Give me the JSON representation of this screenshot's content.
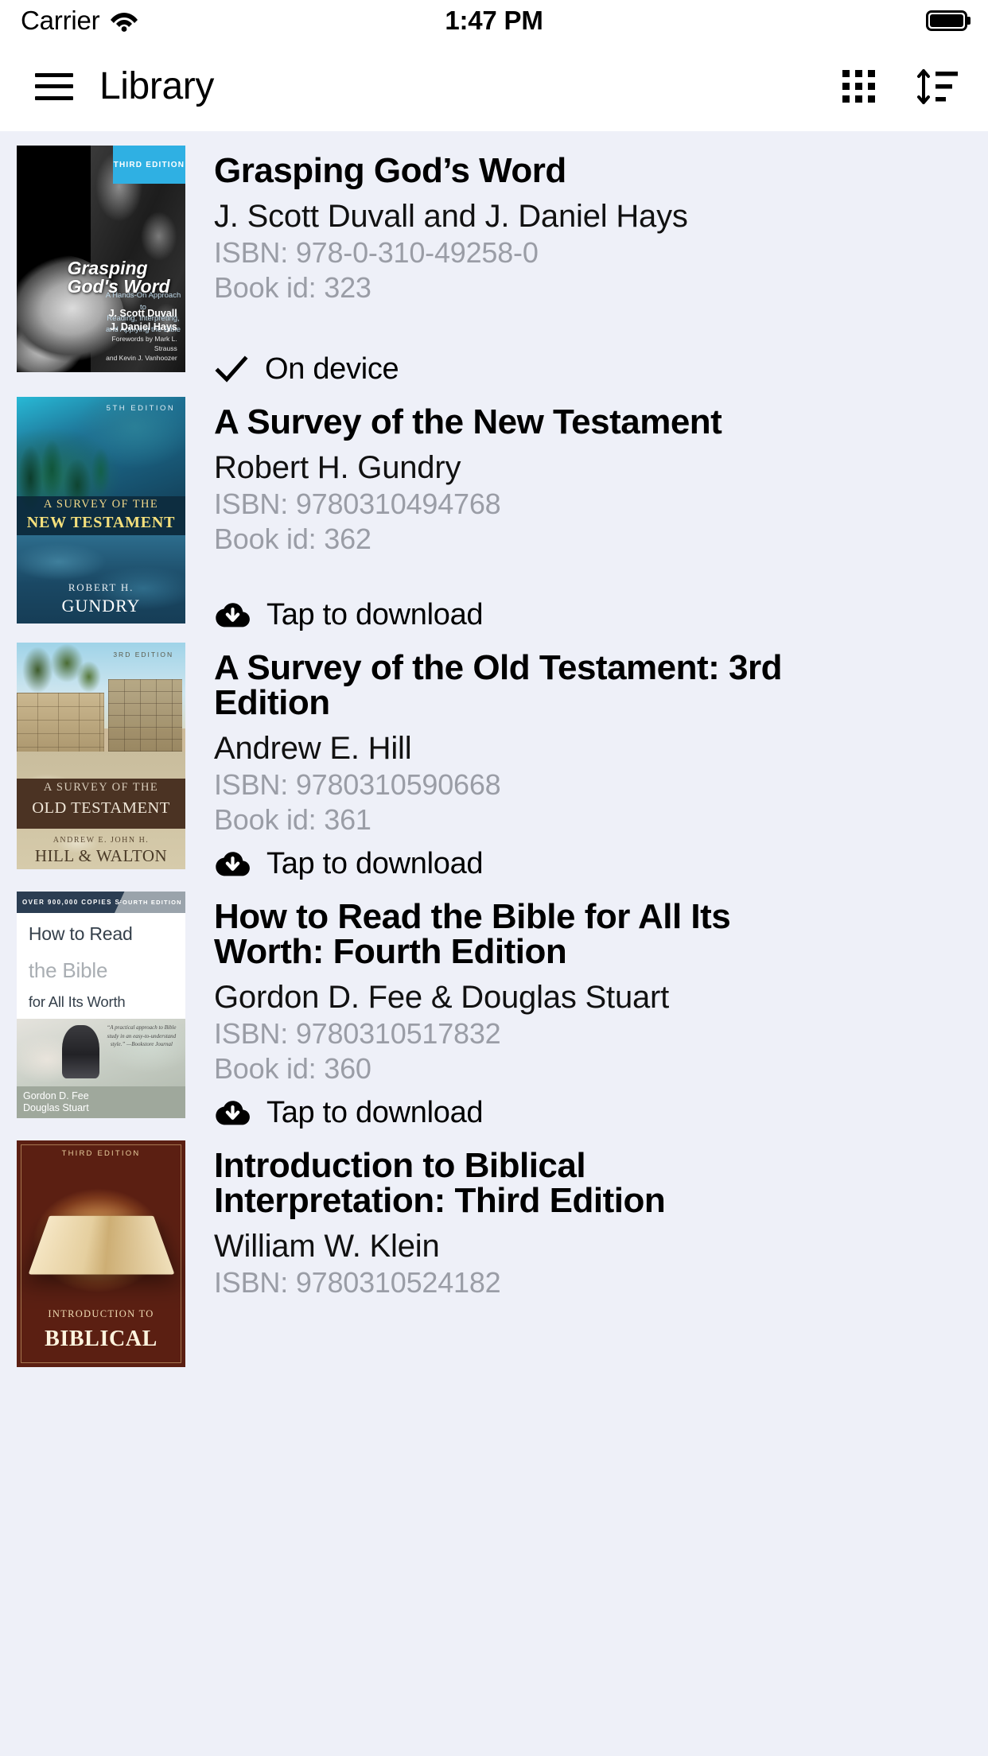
{
  "status_bar": {
    "carrier": "Carrier",
    "time": "1:47 PM",
    "wifi_icon": "wifi-icon",
    "battery_icon": "battery-full-icon"
  },
  "nav_bar": {
    "menu_icon": "hamburger-menu-icon",
    "title": "Library",
    "grid_icon": "grid-view-icon",
    "sort_icon": "sort-icon"
  },
  "labels": {
    "isbn_prefix": "ISBN: ",
    "bookid_prefix": "Book id: ",
    "on_device": "On device",
    "tap_to_download": "Tap to download"
  },
  "colors": {
    "list_background": "#eef0f8",
    "bar_background": "#ffffff",
    "title_text": "#000000",
    "meta_text": "#9a9da6",
    "accent_badge": "#2fb0e3"
  },
  "books": [
    {
      "title": "Grasping God’s Word",
      "author": "J. Scott Duvall and J. Daniel Hays",
      "isbn": "ISBN: 978-0-310-49258-0",
      "book_id": "Book id: 323",
      "status": "On device",
      "status_icon": "checkmark-icon",
      "cover": {
        "style": "ggw",
        "badge": "THIRD EDITION",
        "title": "Grasping God's Word",
        "subtitle": "A Hands-On Approach to\nReading, Interpreting,\nand Applying the Bible",
        "author_line": "J. Scott Duvall\nJ. Daniel Hays",
        "foreword": "Forewords by Mark L. Strauss\nand Kevin J. Vanhoozer"
      }
    },
    {
      "title": "A Survey of the New Testament",
      "author": "Robert H. Gundry",
      "isbn": "ISBN: 9780310494768",
      "book_id": "Book id: 362",
      "status": "Tap to download",
      "status_icon": "cloud-download-icon",
      "cover": {
        "style": "snt",
        "edition": "5TH EDITION",
        "title_line1": "A SURVEY OF THE",
        "title_line2": "NEW TESTAMENT",
        "author_line1": "ROBERT H.",
        "author_line2": "GUNDRY"
      }
    },
    {
      "title": "A Survey of the Old Testament: 3rd Edition",
      "author": "Andrew E. Hill",
      "isbn": "ISBN: 9780310590668",
      "book_id": "Book id: 361",
      "status": "Tap to download",
      "status_icon": "cloud-download-icon",
      "cover": {
        "style": "sot",
        "edition": "3RD EDITION",
        "title_line1": "A SURVEY OF THE",
        "title_line2": "OLD TESTAMENT",
        "author_line1": "ANDREW E.          JOHN H.",
        "author_line2": "HILL  &  WALTON"
      }
    },
    {
      "title": "How to Read the Bible for All Its Worth: Fourth Edition",
      "author": "Gordon D. Fee & Douglas Stuart",
      "isbn": "ISBN: 9780310517832",
      "book_id": "Book id: 360",
      "status": "Tap to download",
      "status_icon": "cloud-download-icon",
      "cover": {
        "style": "htr",
        "banner_left": "OVER 900,000 COPIES SOLD",
        "banner_right": "FOURTH EDITION",
        "title_line1": "How to Read",
        "title_line2": "the Bible",
        "title_line3": "for All Its Worth",
        "quote": "“A practical approach to Bible study in an easy-to-understand style.” —Bookstore Journal",
        "author_line1": "Gordon D. Fee",
        "author_line2": "Douglas Stuart"
      }
    },
    {
      "title": "Introduction to Biblical Interpretation: Third Edition",
      "author": "William W. Klein",
      "isbn": "ISBN: 9780310524182",
      "book_id": "",
      "status": "",
      "status_icon": "",
      "cover": {
        "style": "ibi",
        "edition": "THIRD EDITION",
        "title_line1": "INTRODUCTION TO",
        "title_line2": "BIBLICAL"
      }
    }
  ]
}
